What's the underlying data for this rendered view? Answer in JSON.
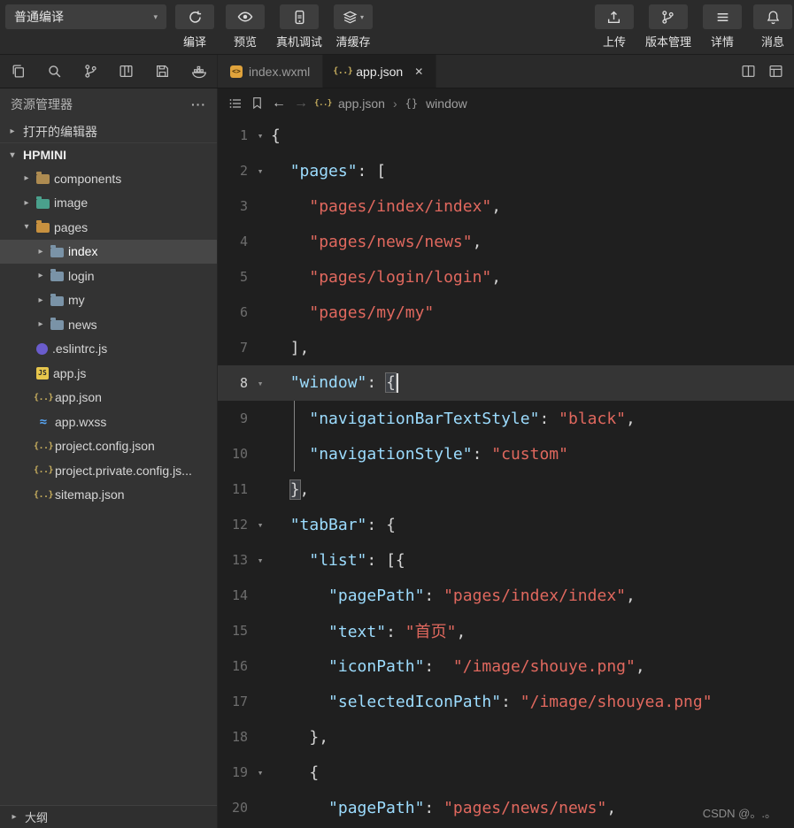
{
  "toolbar": {
    "compile_mode": "普通编译",
    "buttons": [
      {
        "name": "compile-button",
        "icon": "refresh-icon",
        "label": "编译"
      },
      {
        "name": "preview-button",
        "icon": "eye-icon",
        "label": "预览"
      },
      {
        "name": "device-debug-button",
        "icon": "device-debug-icon",
        "label": "真机调试"
      },
      {
        "name": "clear-cache-button",
        "icon": "layers-icon",
        "label": "清缓存",
        "has_dropdown": true
      }
    ],
    "right_buttons": [
      {
        "name": "upload-button",
        "icon": "upload-icon",
        "label": "上传"
      },
      {
        "name": "version-control-button",
        "icon": "branch-icon",
        "label": "版本管理"
      },
      {
        "name": "details-button",
        "icon": "menu-icon",
        "label": "详情"
      },
      {
        "name": "messages-button",
        "icon": "bell-icon",
        "label": "消息"
      }
    ]
  },
  "activity_bar": {
    "icons": [
      "files-icon",
      "search-icon",
      "source-control-icon",
      "board-icon",
      "save-icon",
      "whale-icon"
    ]
  },
  "tabs": {
    "items": [
      {
        "label": "index.wxml",
        "icon": "wxml-file-icon",
        "active": false,
        "closable": false
      },
      {
        "label": "app.json",
        "icon": "json-file-icon",
        "active": true,
        "closable": true
      }
    ],
    "right_icons": [
      "split-editor-icon",
      "editor-layout-icon"
    ]
  },
  "breadcrumb": {
    "file": "app.json",
    "section": "window"
  },
  "sidebar": {
    "title": "资源管理器",
    "open_editors_label": "打开的编辑器",
    "project_name": "HPMINI",
    "outline_label": "大纲",
    "tree": [
      {
        "label": "components",
        "icon": "folder-icon",
        "color": "#ad8b51",
        "depth": 1,
        "expandable": true,
        "expanded": false,
        "selected": false
      },
      {
        "label": "image",
        "icon": "folder-icon",
        "color": "#4aa08c",
        "depth": 1,
        "expandable": true,
        "expanded": false,
        "selected": false
      },
      {
        "label": "pages",
        "icon": "folder-icon",
        "color": "#c8913f",
        "depth": 1,
        "expandable": true,
        "expanded": true,
        "selected": false
      },
      {
        "label": "index",
        "icon": "folder-icon",
        "color": "#7a93a7",
        "depth": 2,
        "expandable": true,
        "expanded": false,
        "selected": true
      },
      {
        "label": "login",
        "icon": "folder-icon",
        "color": "#7a93a7",
        "depth": 2,
        "expandable": true,
        "expanded": false,
        "selected": false
      },
      {
        "label": "my",
        "icon": "folder-icon",
        "color": "#7a93a7",
        "depth": 2,
        "expandable": true,
        "expanded": false,
        "selected": false
      },
      {
        "label": "news",
        "icon": "folder-icon",
        "color": "#7a93a7",
        "depth": 2,
        "expandable": true,
        "expanded": false,
        "selected": false
      },
      {
        "label": ".eslintrc.js",
        "icon": "eslint-icon",
        "depth": 1,
        "expandable": false,
        "expanded": false,
        "selected": false
      },
      {
        "label": "app.js",
        "icon": "js-file-icon",
        "depth": 1,
        "expandable": false,
        "expanded": false,
        "selected": false
      },
      {
        "label": "app.json",
        "icon": "json-file-icon",
        "depth": 1,
        "expandable": false,
        "expanded": false,
        "selected": false
      },
      {
        "label": "app.wxss",
        "icon": "wxss-file-icon",
        "depth": 1,
        "expandable": false,
        "expanded": false,
        "selected": false
      },
      {
        "label": "project.config.json",
        "icon": "json-file-icon",
        "depth": 1,
        "expandable": false,
        "expanded": false,
        "selected": false
      },
      {
        "label": "project.private.config.js...",
        "icon": "json-file-icon",
        "depth": 1,
        "expandable": false,
        "expanded": false,
        "selected": false
      },
      {
        "label": "sitemap.json",
        "icon": "json-file-icon",
        "depth": 1,
        "expandable": false,
        "expanded": false,
        "selected": false
      }
    ]
  },
  "editor": {
    "colors": {
      "key": "#9cdcfe",
      "string": "#e0685e"
    },
    "lines": [
      {
        "num": 1,
        "fold": true,
        "segments": [
          {
            "t": "{",
            "c": "p"
          }
        ]
      },
      {
        "num": 2,
        "fold": true,
        "segments": [
          {
            "t": "  "
          },
          {
            "t": "\"pages\"",
            "c": "k"
          },
          {
            "t": ": [",
            "c": "p"
          }
        ]
      },
      {
        "num": 3,
        "segments": [
          {
            "t": "    "
          },
          {
            "t": "\"pages/index/index\"",
            "c": "s"
          },
          {
            "t": ",",
            "c": "p"
          }
        ]
      },
      {
        "num": 4,
        "segments": [
          {
            "t": "    "
          },
          {
            "t": "\"pages/news/news\"",
            "c": "s"
          },
          {
            "t": ",",
            "c": "p"
          }
        ]
      },
      {
        "num": 5,
        "segments": [
          {
            "t": "    "
          },
          {
            "t": "\"pages/login/login\"",
            "c": "s"
          },
          {
            "t": ",",
            "c": "p"
          }
        ]
      },
      {
        "num": 6,
        "segments": [
          {
            "t": "    "
          },
          {
            "t": "\"pages/my/my\"",
            "c": "s"
          }
        ]
      },
      {
        "num": 7,
        "segments": [
          {
            "t": "  "
          },
          {
            "t": "],",
            "c": "p"
          }
        ]
      },
      {
        "num": 8,
        "fold": true,
        "current": true,
        "caret": true,
        "segments": [
          {
            "t": "  "
          },
          {
            "t": "\"window\"",
            "c": "k"
          },
          {
            "t": ": ",
            "c": "p"
          },
          {
            "t": "{",
            "c": "p bm"
          }
        ]
      },
      {
        "num": 9,
        "guide": true,
        "segments": [
          {
            "t": "    "
          },
          {
            "t": "\"navigationBarTextStyle\"",
            "c": "k"
          },
          {
            "t": ": ",
            "c": "p"
          },
          {
            "t": "\"black\"",
            "c": "s"
          },
          {
            "t": ",",
            "c": "p"
          }
        ]
      },
      {
        "num": 10,
        "guide": true,
        "segments": [
          {
            "t": "    "
          },
          {
            "t": "\"navigationStyle\"",
            "c": "k"
          },
          {
            "t": ": ",
            "c": "p"
          },
          {
            "t": "\"custom\"",
            "c": "s"
          }
        ]
      },
      {
        "num": 11,
        "segments": [
          {
            "t": "  "
          },
          {
            "t": "}",
            "c": "p bm"
          },
          {
            "t": ",",
            "c": "p"
          }
        ]
      },
      {
        "num": 12,
        "fold": true,
        "segments": [
          {
            "t": "  "
          },
          {
            "t": "\"tabBar\"",
            "c": "k"
          },
          {
            "t": ": {",
            "c": "p"
          }
        ]
      },
      {
        "num": 13,
        "fold": true,
        "segments": [
          {
            "t": "    "
          },
          {
            "t": "\"list\"",
            "c": "k"
          },
          {
            "t": ": [{",
            "c": "p"
          }
        ]
      },
      {
        "num": 14,
        "segments": [
          {
            "t": "      "
          },
          {
            "t": "\"pagePath\"",
            "c": "k"
          },
          {
            "t": ": ",
            "c": "p"
          },
          {
            "t": "\"pages/index/index\"",
            "c": "s"
          },
          {
            "t": ",",
            "c": "p"
          }
        ]
      },
      {
        "num": 15,
        "segments": [
          {
            "t": "      "
          },
          {
            "t": "\"text\"",
            "c": "k"
          },
          {
            "t": ": ",
            "c": "p"
          },
          {
            "t": "\"首页\"",
            "c": "s"
          },
          {
            "t": ",",
            "c": "p"
          }
        ]
      },
      {
        "num": 16,
        "segments": [
          {
            "t": "      "
          },
          {
            "t": "\"iconPath\"",
            "c": "k"
          },
          {
            "t": ":  ",
            "c": "p"
          },
          {
            "t": "\"/image/shouye.png\"",
            "c": "s"
          },
          {
            "t": ",",
            "c": "p"
          }
        ]
      },
      {
        "num": 17,
        "segments": [
          {
            "t": "      "
          },
          {
            "t": "\"selectedIconPath\"",
            "c": "k"
          },
          {
            "t": ": ",
            "c": "p"
          },
          {
            "t": "\"/image/shouyea.png\"",
            "c": "s"
          }
        ]
      },
      {
        "num": 18,
        "segments": [
          {
            "t": "    "
          },
          {
            "t": "},",
            "c": "p"
          }
        ]
      },
      {
        "num": 19,
        "fold": true,
        "segments": [
          {
            "t": "    "
          },
          {
            "t": "{",
            "c": "p"
          }
        ]
      },
      {
        "num": 20,
        "segments": [
          {
            "t": "      "
          },
          {
            "t": "\"pagePath\"",
            "c": "k"
          },
          {
            "t": ": ",
            "c": "p"
          },
          {
            "t": "\"pages/news/news\"",
            "c": "s"
          },
          {
            "t": ",",
            "c": "p"
          }
        ]
      }
    ]
  },
  "watermark": "CSDN @。.。"
}
